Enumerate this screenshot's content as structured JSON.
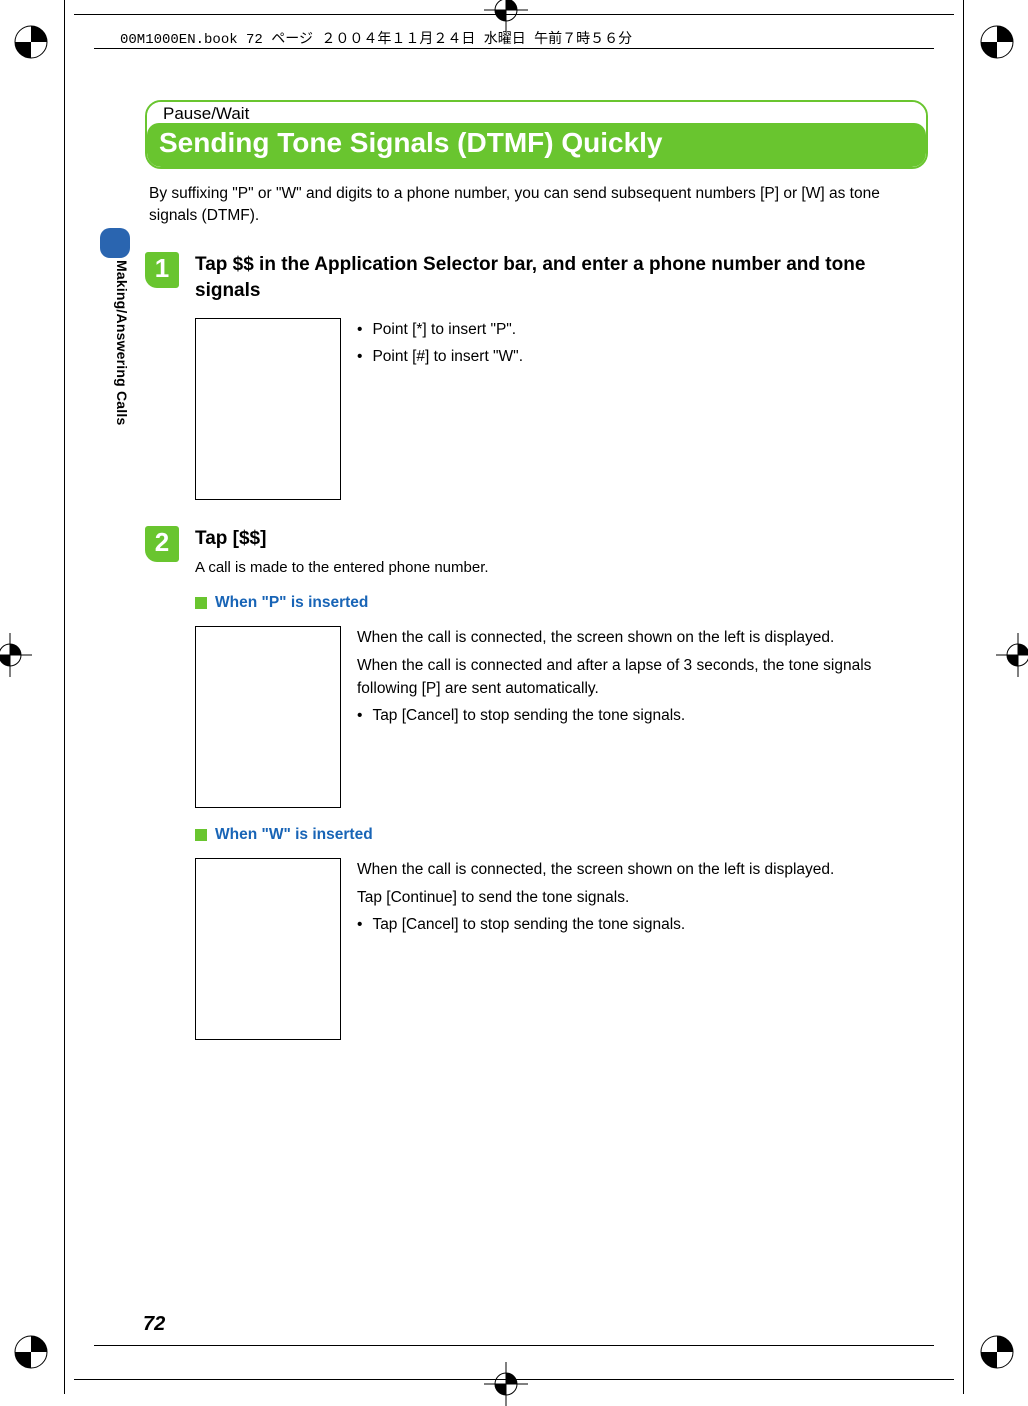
{
  "header_meta": "00M1000EN.book  72 ページ  ２００４年１１月２４日  水曜日  午前７時５６分",
  "side_label": "Making/Answering Calls",
  "eyebrow": "Pause/Wait",
  "title": "Sending Tone Signals (DTMF) Quickly",
  "intro": "By suffixing \"P\" or \"W\" and digits to a phone number, you can send subsequent numbers [P] or [W] as tone signals (DTMF).",
  "steps": [
    {
      "num": "1",
      "heading": "Tap $$ in the Application Selector bar, and enter a phone number and tone signals",
      "bullets": [
        "Point [*] to insert \"P\".",
        "Point [#] to insert \"W\"."
      ]
    },
    {
      "num": "2",
      "heading": "Tap [$$]",
      "sub": "A call is made to the entered phone number.",
      "sections": [
        {
          "subheading": "When \"P\" is inserted",
          "paragraphs": [
            "When the call is connected, the screen shown on the left is displayed.",
            "When the call is connected and after a lapse of 3 seconds, the tone signals following [P] are sent automatically."
          ],
          "bullets": [
            "Tap [Cancel] to stop sending the tone signals."
          ]
        },
        {
          "subheading": "When \"W\" is inserted",
          "paragraphs": [
            "When the call is connected, the screen shown on the left is displayed.",
            "Tap [Continue] to send the tone signals."
          ],
          "bullets": [
            "Tap [Cancel] to stop sending the tone signals."
          ]
        }
      ]
    }
  ],
  "page_number": "72"
}
